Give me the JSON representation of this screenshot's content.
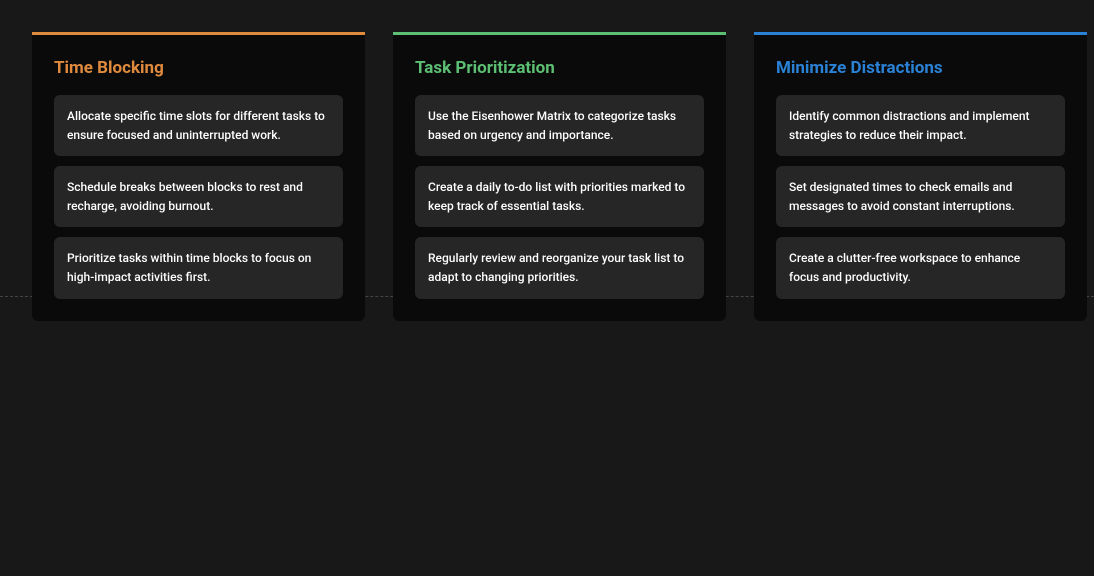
{
  "cards": [
    {
      "title": "Time Blocking",
      "color": "orange",
      "items": [
        "Allocate specific time slots for different tasks to ensure focused and uninterrupted work.",
        "Schedule breaks between blocks to rest and recharge, avoiding burnout.",
        "Prioritize tasks within time blocks to focus on high-impact activities first."
      ]
    },
    {
      "title": "Task Prioritization",
      "color": "green",
      "items": [
        "Use the Eisenhower Matrix to categorize tasks based on urgency and importance.",
        "Create a daily to-do list with priorities marked to keep track of essential tasks.",
        "Regularly review and reorganize your task list to adapt to changing priorities."
      ]
    },
    {
      "title": "Minimize Distractions",
      "color": "blue",
      "items": [
        "Identify common distractions and implement strategies to reduce their impact.",
        "Set designated times to check emails and messages to avoid constant interruptions.",
        "Create a clutter-free workspace to enhance focus and productivity."
      ]
    }
  ]
}
